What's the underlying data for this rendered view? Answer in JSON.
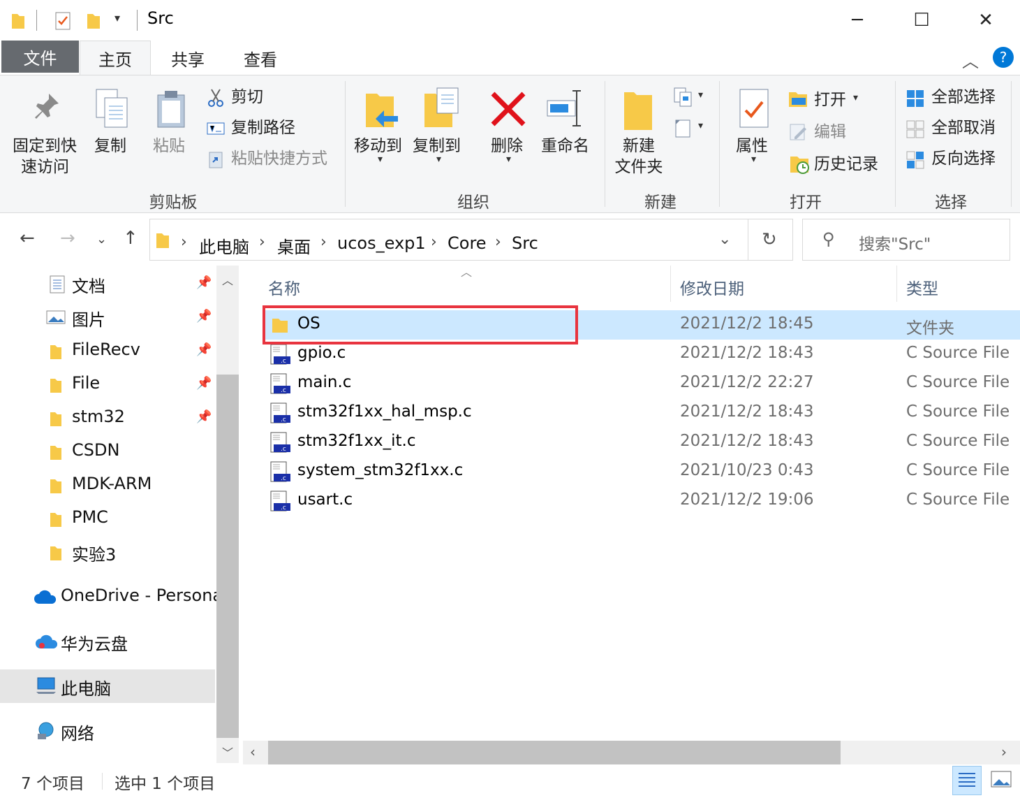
{
  "window": {
    "title": "Src"
  },
  "ribbon_tabs": [
    "文件",
    "主页",
    "共享",
    "查看"
  ],
  "clipboard": {
    "pin_line1": "固定到快",
    "pin_line2": "速访问",
    "copy": "复制",
    "paste": "粘贴",
    "cut": "剪切",
    "copy_path": "复制路径",
    "paste_shortcut": "粘贴快捷方式",
    "group": "剪贴板"
  },
  "organize": {
    "move_to": "移动到",
    "copy_to": "复制到",
    "delete": "删除",
    "rename": "重命名",
    "group": "组织"
  },
  "new": {
    "new_folder_line1": "新建",
    "new_folder_line2": "文件夹",
    "group": "新建"
  },
  "open": {
    "properties": "属性",
    "open": "打开",
    "edit": "编辑",
    "history": "历史记录",
    "group": "打开"
  },
  "select": {
    "select_all": "全部选择",
    "select_none": "全部取消",
    "invert": "反向选择",
    "group": "选择"
  },
  "address": {
    "crumbs": [
      "此电脑",
      "桌面",
      "ucos_exp1",
      "Core",
      "Src"
    ],
    "search_placeholder": "搜索\"Src\""
  },
  "nav": {
    "quick": [
      {
        "label": "文档",
        "pinned": true
      },
      {
        "label": "图片",
        "pinned": true
      },
      {
        "label": "FileRecv",
        "pinned": true
      },
      {
        "label": "File",
        "pinned": true
      },
      {
        "label": "stm32",
        "pinned": true
      },
      {
        "label": "CSDN",
        "pinned": false
      },
      {
        "label": "MDK-ARM",
        "pinned": false
      },
      {
        "label": "PMC",
        "pinned": false
      },
      {
        "label": "实验3",
        "pinned": false
      }
    ],
    "onedrive": "OneDrive - Persona",
    "huawei": "华为云盘",
    "thispc": "此电脑",
    "network": "网络"
  },
  "columns": {
    "name": "名称",
    "date": "修改日期",
    "type": "类型"
  },
  "files": [
    {
      "name": "OS",
      "date": "2021/12/2 18:45",
      "type": "文件夹",
      "kind": "folder",
      "selected": true
    },
    {
      "name": "gpio.c",
      "date": "2021/12/2 18:43",
      "type": "C Source File",
      "kind": "c"
    },
    {
      "name": "main.c",
      "date": "2021/12/2 22:27",
      "type": "C Source File",
      "kind": "c"
    },
    {
      "name": "stm32f1xx_hal_msp.c",
      "date": "2021/12/2 18:43",
      "type": "C Source File",
      "kind": "c"
    },
    {
      "name": "stm32f1xx_it.c",
      "date": "2021/12/2 18:43",
      "type": "C Source File",
      "kind": "c"
    },
    {
      "name": "system_stm32f1xx.c",
      "date": "2021/10/23 0:43",
      "type": "C Source File",
      "kind": "c"
    },
    {
      "name": "usart.c",
      "date": "2021/12/2 19:06",
      "type": "C Source File",
      "kind": "c"
    }
  ],
  "status": {
    "count": "7 个项目",
    "selected": "选中 1 个项目"
  },
  "colors": {
    "selection": "#cce8ff",
    "highlight": "#e8343f",
    "folder": "#f7c948",
    "accent": "#0078d7"
  }
}
